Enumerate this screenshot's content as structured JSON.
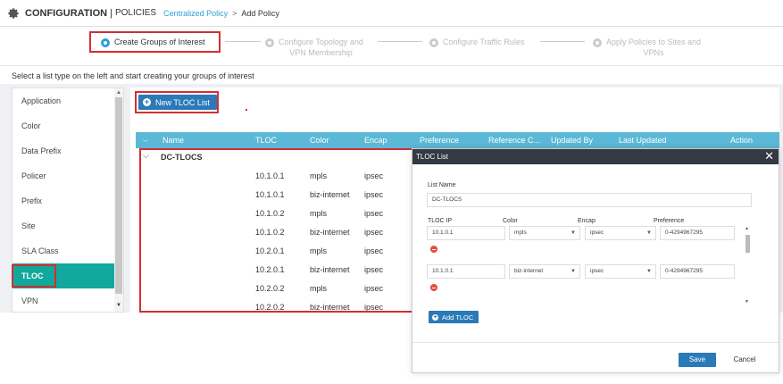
{
  "header": {
    "title": "CONFIGURATION",
    "separator": "|",
    "section": "POLICIES",
    "breadcrumb_link": "Centralized Policy",
    "breadcrumb_arrow": ">",
    "breadcrumb_current": "Add Policy"
  },
  "wizard": {
    "steps": [
      {
        "line1": "Create Groups of Interest",
        "line2": ""
      },
      {
        "line1": "Configure Topology and",
        "line2": "VPN Membership"
      },
      {
        "line1": "Configure Traffic Rules",
        "line2": ""
      },
      {
        "line1": "Apply Policies to Sites and",
        "line2": "VPNs"
      }
    ]
  },
  "instruction": "Select a list type on the left and start creating your groups of interest",
  "sidebar": {
    "items": [
      "Application",
      "Color",
      "Data Prefix",
      "Policer",
      "Prefix",
      "Site",
      "SLA Class",
      "TLOC",
      "VPN"
    ]
  },
  "new_button": "New TLOC List",
  "table": {
    "columns": [
      "Name",
      "TLOC",
      "Color",
      "Encap",
      "Preference",
      "Reference C...",
      "Updated By",
      "Last Updated",
      "Action"
    ],
    "group_name": "DC-TLOCS",
    "rows": [
      {
        "tloc": "10.1.0.1",
        "color": "mpls",
        "encap": "ipsec"
      },
      {
        "tloc": "10.1.0.1",
        "color": "biz-internet",
        "encap": "ipsec"
      },
      {
        "tloc": "10.1.0.2",
        "color": "mpls",
        "encap": "ipsec"
      },
      {
        "tloc": "10.1.0.2",
        "color": "biz-internet",
        "encap": "ipsec"
      },
      {
        "tloc": "10.2.0.1",
        "color": "mpls",
        "encap": "ipsec"
      },
      {
        "tloc": "10.2.0.1",
        "color": "biz-internet",
        "encap": "ipsec"
      },
      {
        "tloc": "10.2.0.2",
        "color": "mpls",
        "encap": "ipsec"
      },
      {
        "tloc": "10.2.0.2",
        "color": "biz-internet",
        "encap": "ipsec"
      }
    ]
  },
  "modal": {
    "title": "TLOC List",
    "close": "✕",
    "list_name_label": "List Name",
    "list_name_value": "DC-TLOCS",
    "col_tloc_ip": "TLOC IP",
    "col_color": "Color",
    "col_encap": "Encap",
    "col_preference": "Preference",
    "entries": [
      {
        "ip": "10.1.0.1",
        "color": "mpls",
        "encap": "ipsec",
        "preference": "0-4294967295"
      },
      {
        "ip": "10.1.0.1",
        "color": "biz-internet",
        "encap": "ipsec",
        "preference": "0-4294967295"
      }
    ],
    "add_label": "Add TLOC",
    "save_label": "Save",
    "cancel_label": "Cancel"
  },
  "colors": {
    "accent_blue": "#2a7ab8",
    "link_blue": "#2a9fd6",
    "table_header": "#5bb8d6",
    "active_teal": "#12a89d",
    "highlight_red": "#d32f2f",
    "modal_header": "#333a44"
  }
}
